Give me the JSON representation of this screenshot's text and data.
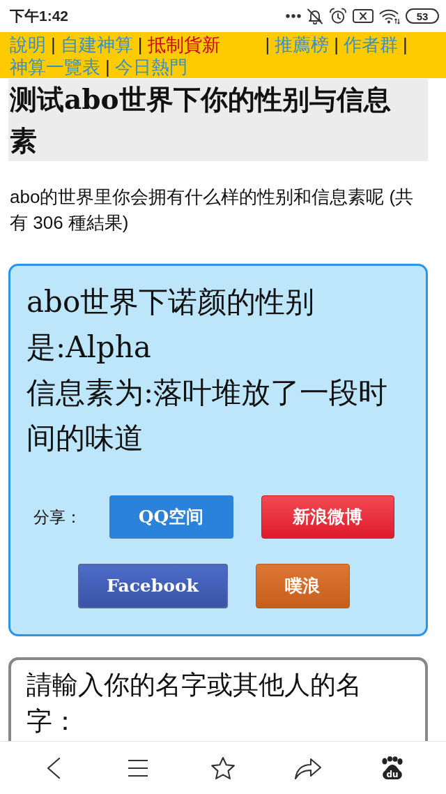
{
  "status_bar": {
    "time": "下午1:42",
    "battery": "53"
  },
  "nav": {
    "items": [
      {
        "kind": "link",
        "label": "說明"
      },
      {
        "kind": "separator",
        "label": "|"
      },
      {
        "kind": "link",
        "label": "自建神算"
      },
      {
        "kind": "separator",
        "label": "|"
      },
      {
        "kind": "hot",
        "label": "抵制貨新"
      },
      {
        "kind": "separator",
        "label": "|"
      },
      {
        "kind": "link",
        "label": "推薦榜"
      },
      {
        "kind": "separator",
        "label": "|"
      },
      {
        "kind": "link",
        "label": "作者群"
      },
      {
        "kind": "separator",
        "label": "|"
      },
      {
        "kind": "link",
        "label": "神算一覽表"
      },
      {
        "kind": "separator",
        "label": "|"
      },
      {
        "kind": "link",
        "label": "今日熱門"
      }
    ]
  },
  "title": "测试abo世界下你的性别与信息素",
  "description": "abo的世界里你会拥有什么样的性别和信息素呢 (共有 306 種結果)",
  "result": {
    "lines": [
      "abo世界下诺颜的性别是:Alpha",
      "信息素为:落叶堆放了一段时间的味道"
    ]
  },
  "share": {
    "label": "分享：",
    "buttons": [
      {
        "kind": "qq",
        "label": "QQ空间"
      },
      {
        "kind": "weibo",
        "label": "新浪微博"
      },
      {
        "kind": "facebook",
        "label": "Facebook"
      },
      {
        "kind": "plurk",
        "label": "噗浪"
      }
    ]
  },
  "name_form": {
    "label": "請輸入你的名字或其他人的名字："
  },
  "toolbar": {
    "buttons": [
      {
        "kind": "back"
      },
      {
        "kind": "menu"
      },
      {
        "kind": "bookmark"
      },
      {
        "kind": "share"
      },
      {
        "kind": "logo",
        "logo_text": "du"
      }
    ]
  }
}
